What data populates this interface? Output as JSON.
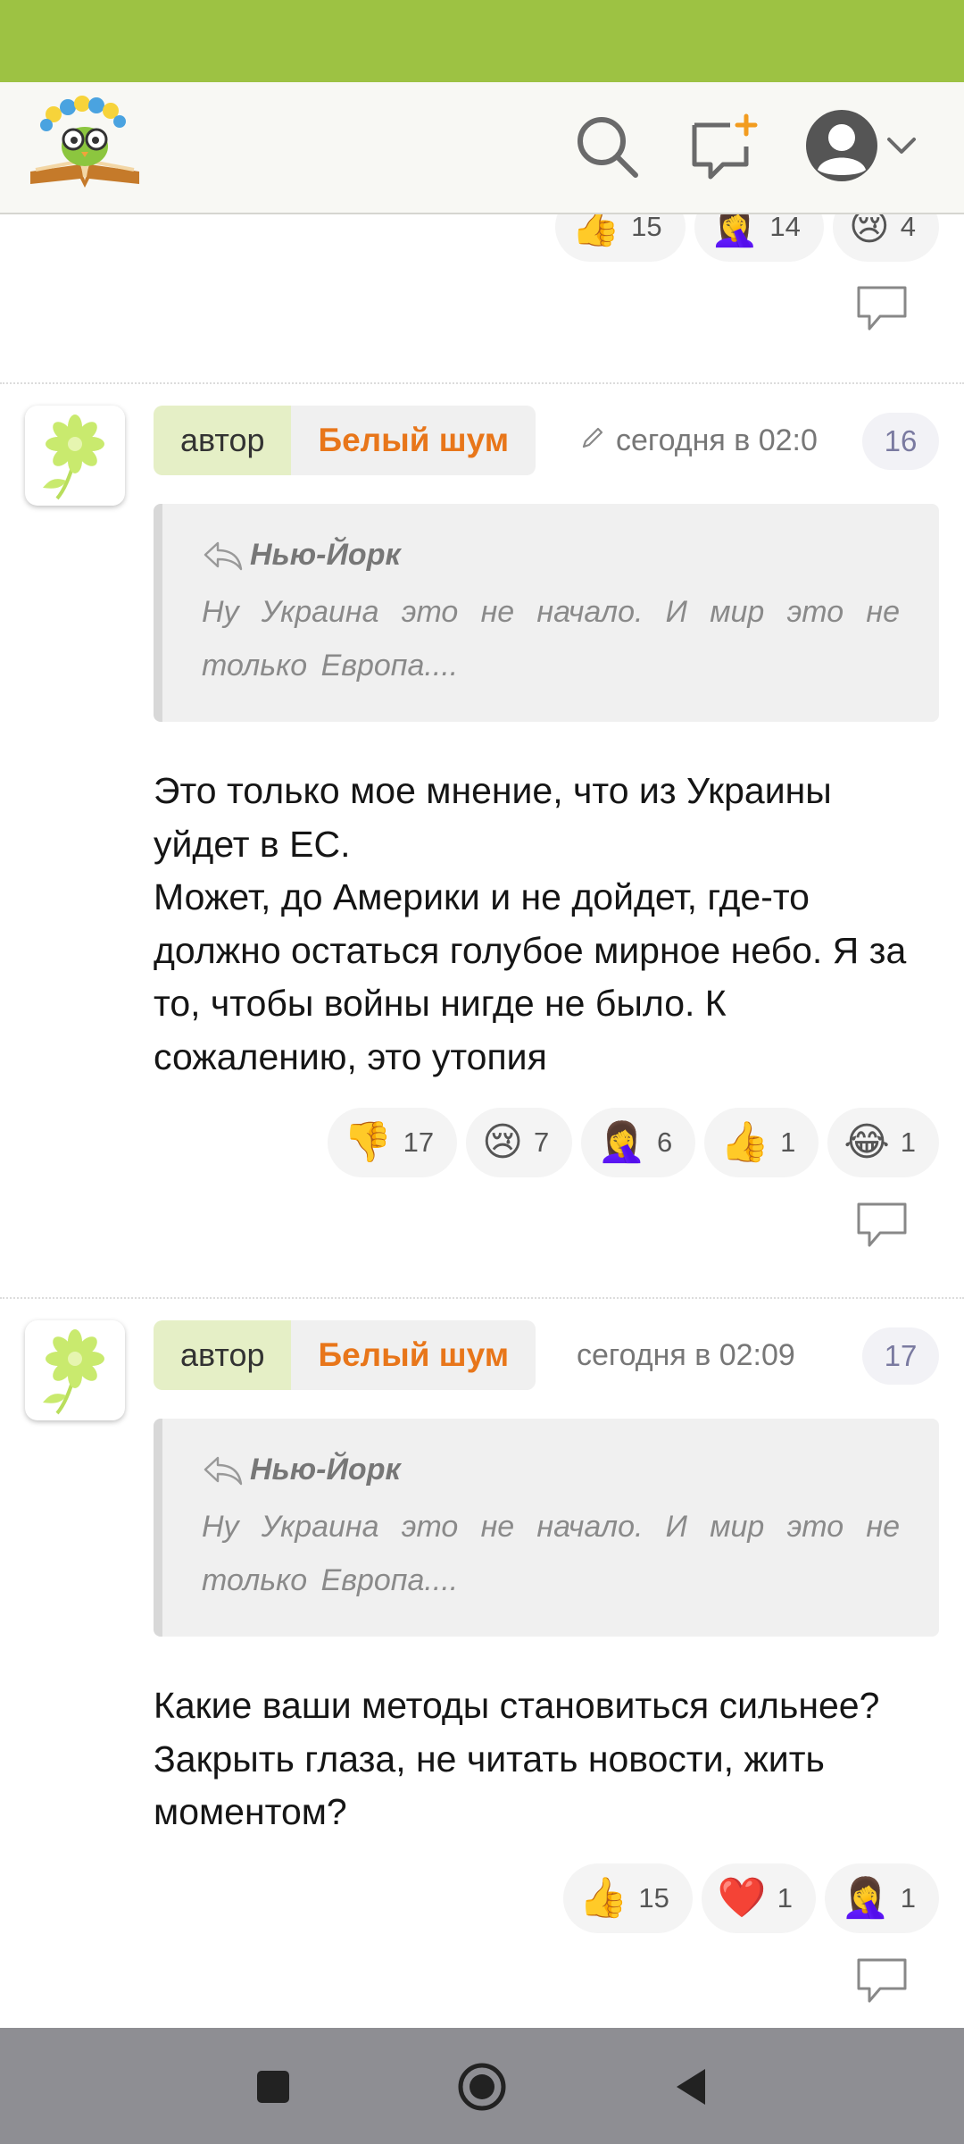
{
  "header": {
    "logo_icon": "book-owl-logo",
    "search_icon": "search-icon",
    "new_post_icon": "new-message-icon",
    "profile_icon": "user-avatar-icon",
    "menu_icon": "chevron-down-icon"
  },
  "top_fragment": {
    "reactions": [
      {
        "emoji": "👍",
        "count": "15"
      },
      {
        "emoji": "🤦‍♀️",
        "count": "14"
      },
      {
        "emoji": "😢",
        "count": "4"
      }
    ]
  },
  "posts": [
    {
      "role": "автор",
      "author": "Белый шум",
      "timestamp": "сегодня в 02:0",
      "edited": true,
      "number": "16",
      "quote_author": "Нью-Йорк",
      "quote_text": "Ну Украина это не начало. И мир это не только Европа....",
      "text": "Это только мое мнение, что из Украины уйдет в ЕС.\nМожет, до Америки и не дойдет, где-то должно остаться голубое мирное небо. Я за то, чтобы войны нигде не было. К сожалению, это утопия",
      "reactions": [
        {
          "emoji": "👎",
          "count": "17"
        },
        {
          "emoji": "😢",
          "count": "7"
        },
        {
          "emoji": "🤦‍♀️",
          "count": "6"
        },
        {
          "emoji": "👍",
          "count": "1"
        },
        {
          "emoji": "😂",
          "count": "1"
        }
      ]
    },
    {
      "role": "автор",
      "author": "Белый шум",
      "timestamp": "сегодня в 02:09",
      "edited": false,
      "number": "17",
      "quote_author": "Нью-Йорк",
      "quote_text": "Ну Украина это не начало. И мир это не только Европа....",
      "text": "Какие ваши методы становиться сильнее? Закрыть глаза, не читать новости, жить моментом?",
      "reactions": [
        {
          "emoji": "👍",
          "count": "15"
        },
        {
          "emoji": "❤️",
          "count": "1"
        },
        {
          "emoji": "🤦‍♀️",
          "count": "1"
        }
      ]
    }
  ],
  "colors": {
    "status_bar": "#9dc243",
    "author_name": "#e8761a",
    "role_chip": "#e5efc6",
    "nav_bar": "#8e8e93"
  },
  "navigation": {
    "recent_icon": "square-recent-apps-icon",
    "home_icon": "circle-home-icon",
    "back_icon": "triangle-back-icon"
  }
}
